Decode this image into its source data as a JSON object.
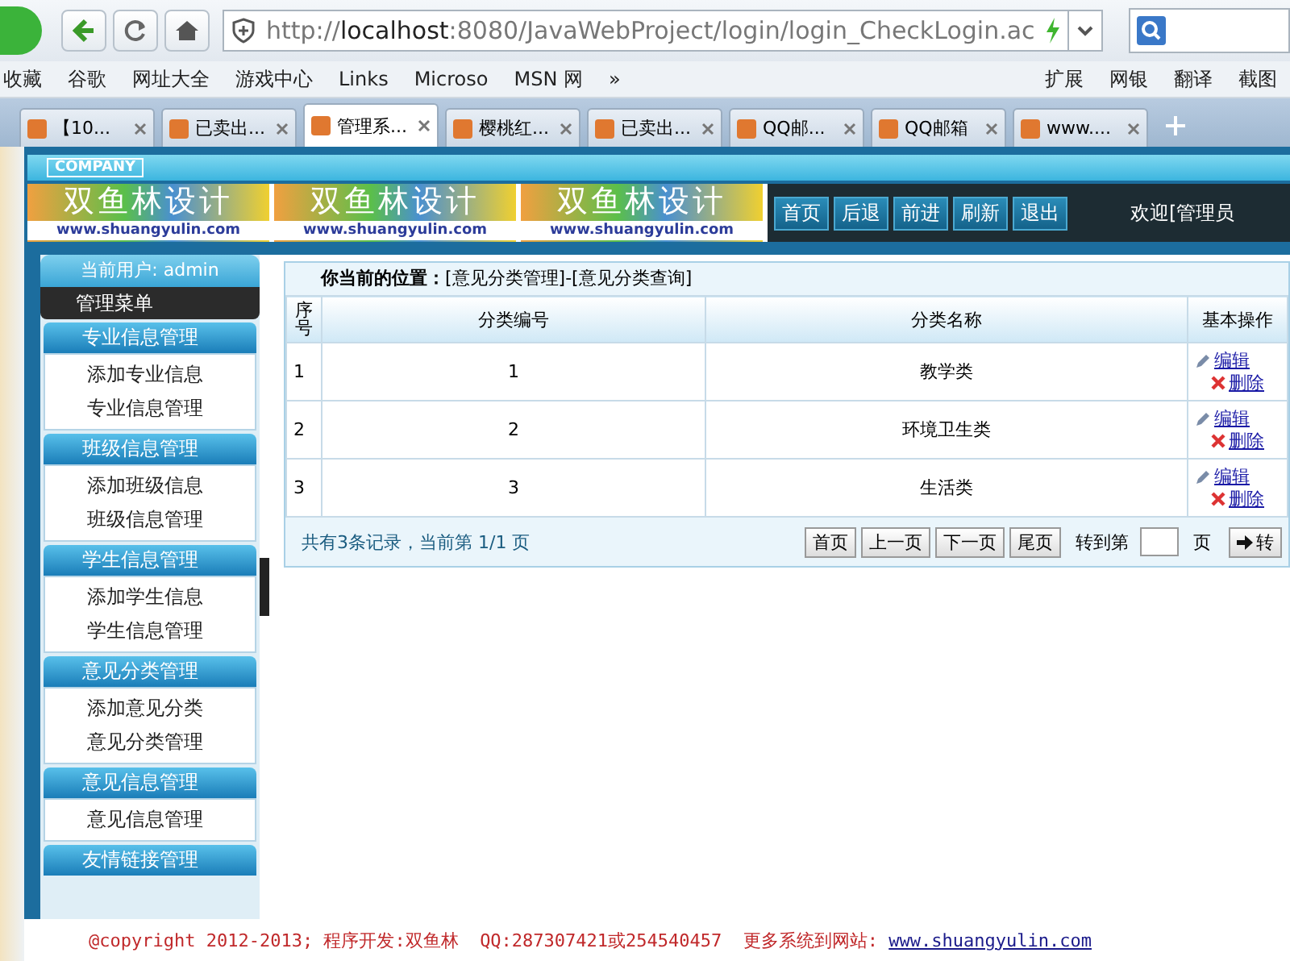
{
  "browser": {
    "url": "http://**localhost**:8080/JavaWebProject/login/login_CheckLogin.ac",
    "bookmarks": [
      "收藏",
      "谷歌",
      "网址大全",
      "游戏中心",
      "Links",
      "Microso",
      "MSN 网",
      "»"
    ],
    "bookmarks_right": [
      "扩展",
      "网银",
      "翻译",
      "截图"
    ],
    "tabs": [
      {
        "label": "【10...",
        "selected": false
      },
      {
        "label": "已卖出...",
        "selected": false
      },
      {
        "label": "管理系...",
        "selected": true
      },
      {
        "label": "樱桃红...",
        "selected": false
      },
      {
        "label": "已卖出...",
        "selected": false
      },
      {
        "label": "QQ邮...",
        "selected": false
      },
      {
        "label": "QQ邮箱",
        "selected": false
      },
      {
        "label": "www....",
        "selected": false
      }
    ]
  },
  "header": {
    "company": "COMPANY",
    "logos": [
      {
        "title": "双鱼林设计",
        "url": "www.shuangyulin.com"
      },
      {
        "title": "双鱼林设计",
        "url": "www.shuangyulin.com"
      },
      {
        "title": "双鱼林设计",
        "url": "www.shuangyulin.com"
      }
    ],
    "nav": [
      "首页",
      "后退",
      "前进",
      "刷新",
      "退出"
    ],
    "welcome": "欢迎[管理员"
  },
  "sidebar": {
    "user": "当前用户: admin",
    "menu_title": "管理菜单",
    "groups": [
      {
        "title": "专业信息管理",
        "items": [
          "添加专业信息",
          "专业信息管理"
        ]
      },
      {
        "title": "班级信息管理",
        "items": [
          "添加班级信息",
          "班级信息管理"
        ]
      },
      {
        "title": "学生信息管理",
        "items": [
          "添加学生信息",
          "学生信息管理"
        ]
      },
      {
        "title": "意见分类管理",
        "items": [
          "添加意见分类",
          "意见分类管理"
        ]
      },
      {
        "title": "意见信息管理",
        "items": [
          "意见信息管理"
        ]
      },
      {
        "title": "友情链接管理"
      }
    ]
  },
  "breadcrumb": "**你当前的位置：**[意见分类管理]-[意见分类查询]",
  "table": {
    "columns": [
      "序号",
      "分类编号",
      "分类名称",
      "基本操作"
    ],
    "rows": [
      {
        "cells": [
          "1",
          "1",
          "教学类"
        ],
        "actions": [
          "编辑",
          "删除"
        ]
      },
      {
        "cells": [
          "2",
          "2",
          "环境卫生类"
        ],
        "actions": [
          "编辑",
          "删除"
        ]
      },
      {
        "cells": [
          "3",
          "3",
          "生活类"
        ],
        "actions": [
          "编辑",
          "删除"
        ]
      }
    ]
  },
  "pager": {
    "summary": "共有3条记录，当前第 1/1 页",
    "buttons": [
      "首页",
      "上一页",
      "下一页",
      "尾页"
    ],
    "goto_label": "转到第",
    "page_unit": "页",
    "go": "转"
  },
  "footer": {
    "text": "@copyright 2012-2013; 程序开发:双鱼林  QQ:287307421或254540457  更多系统到网站: ",
    "link": "www.shuangyulin.com"
  }
}
